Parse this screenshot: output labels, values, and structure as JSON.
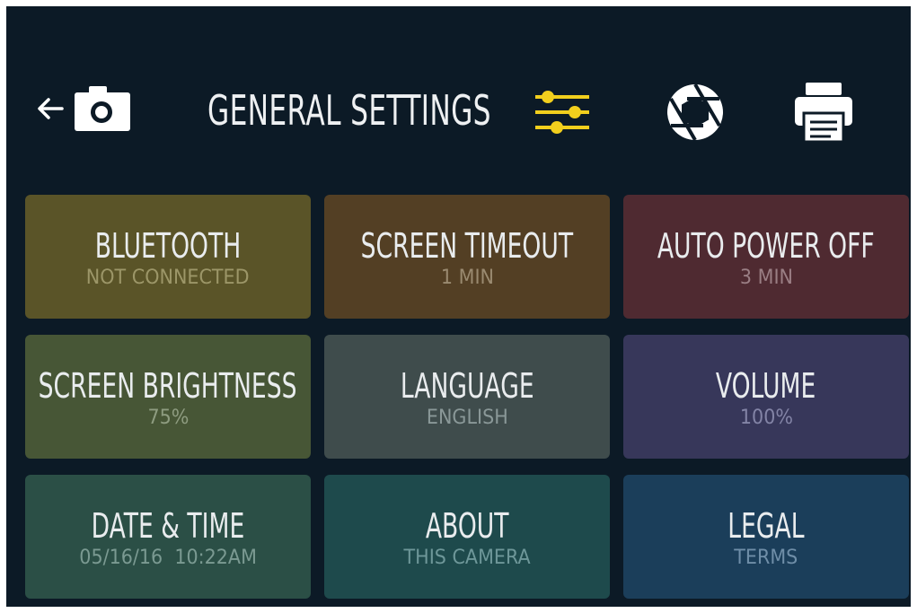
{
  "header": {
    "back_icon": "left-arrow-icon",
    "camera_icon": "camera-icon",
    "title": "GENERAL SETTINGS",
    "tabs": [
      {
        "icon": "sliders-icon",
        "active": true,
        "color": "#f2cf1d"
      },
      {
        "icon": "aperture-icon",
        "active": false,
        "color": "#ffffff"
      },
      {
        "icon": "printer-icon",
        "active": false,
        "color": "#ffffff"
      }
    ]
  },
  "colors": {
    "background": "#0c1a26",
    "title_text": "#eef0f2",
    "accent": "#f2cf1d"
  },
  "tiles": [
    {
      "label": "BLUETOOTH",
      "value": "NOT CONNECTED",
      "bg": "#5a5428",
      "value_color": "#9c9668"
    },
    {
      "label": "SCREEN TIMEOUT",
      "value": "1 MIN",
      "bg": "#533f24",
      "value_color": "#9a8a70"
    },
    {
      "label": "AUTO POWER OFF",
      "value": "3 MIN",
      "bg": "#4f2a31",
      "value_color": "#9a7e84"
    },
    {
      "label": "SCREEN BRIGHTNESS",
      "value": "75%",
      "bg": "#475636",
      "value_color": "#8e9c80"
    },
    {
      "label": "LANGUAGE",
      "value": "ENGLISH",
      "bg": "#3f4c4c",
      "value_color": "#8a9898"
    },
    {
      "label": "VOLUME",
      "value": "100%",
      "bg": "#37375a",
      "value_color": "#8384a6"
    },
    {
      "label": "DATE & TIME",
      "value": "05/16/16  10:22AM",
      "bg": "#2b4f46",
      "value_color": "#7b9a92"
    },
    {
      "label": "ABOUT",
      "value": "THIS CAMERA",
      "bg": "#1e4a4c",
      "value_color": "#6e9799"
    },
    {
      "label": "LEGAL",
      "value": "TERMS",
      "bg": "#1b3e5a",
      "value_color": "#6f8ea8"
    }
  ]
}
